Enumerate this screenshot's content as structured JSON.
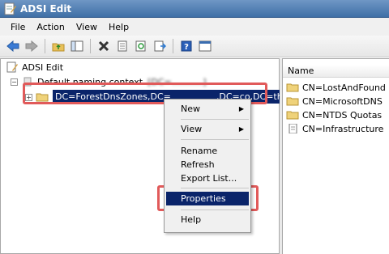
{
  "window": {
    "title": "ADSI Edit"
  },
  "menubar": [
    "File",
    "Action",
    "View",
    "Help"
  ],
  "toolbar": {
    "icons": [
      "back-arrow-icon",
      "forward-arrow-icon",
      "up-folder-icon",
      "show-hide-tree-icon",
      "delete-icon",
      "properties-sheet-icon",
      "refresh-icon",
      "export-list-icon",
      "help-icon",
      "console-icon"
    ]
  },
  "tree": {
    "root": "ADSI Edit",
    "context": "Default naming context",
    "context_blurred": "[DC=...........]",
    "expander": "+",
    "selected": {
      "prefix": "DC=ForestDnsZones,DC=",
      "suffix": ",DC=co,DC=th"
    }
  },
  "context_menu": {
    "items": [
      "New",
      "View",
      "Rename",
      "Refresh",
      "Export List...",
      "Properties",
      "Help"
    ],
    "highlighted": "Properties"
  },
  "list": {
    "column": "Name",
    "rows": [
      "CN=LostAndFound",
      "CN=MicrosoftDNS",
      "CN=NTDS Quotas",
      "CN=Infrastructure"
    ]
  },
  "colors": {
    "highlight": "#0a246a",
    "callout": "#e15a5a"
  }
}
